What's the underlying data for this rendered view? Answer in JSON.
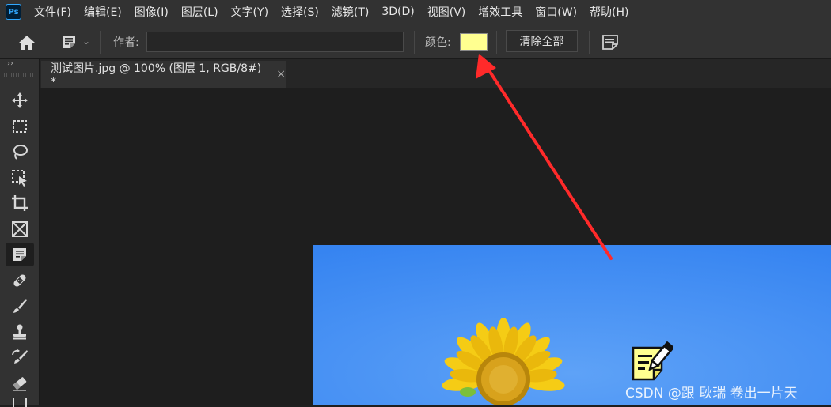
{
  "app": {
    "logo": "Ps"
  },
  "menu": [
    "文件(F)",
    "编辑(E)",
    "图像(I)",
    "图层(L)",
    "文字(Y)",
    "选择(S)",
    "滤镜(T)",
    "3D(D)",
    "视图(V)",
    "增效工具",
    "窗口(W)",
    "帮助(H)"
  ],
  "options": {
    "author_label": "作者:",
    "author_value": "",
    "color_label": "颜色:",
    "color_value": "#ffff90",
    "clear_all_label": "清除全部"
  },
  "toolbar": {
    "collapse": "››",
    "tools": [
      "move-tool-icon",
      "rectangular-marquee-icon",
      "lasso-icon",
      "object-selection-icon",
      "crop-icon",
      "frame-icon",
      "note-tool-icon",
      "healing-brush-icon",
      "brush-icon",
      "clone-stamp-icon",
      "history-brush-icon",
      "eraser-icon"
    ]
  },
  "document": {
    "tab_title": "测试图片.jpg @ 100% (图层 1, RGB/8#) *",
    "close_glyph": "×"
  },
  "watermark": "CSDN @跟 耿瑞 卷出一片天",
  "colors": {
    "annotation_arrow": "#ff2a2a",
    "sky": "#3a87f2"
  }
}
